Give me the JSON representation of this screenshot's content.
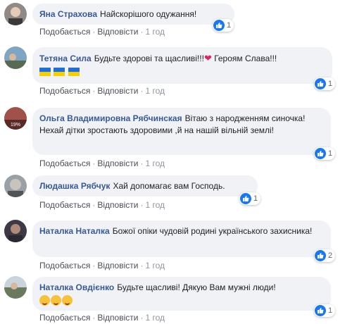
{
  "actions": {
    "like": "Подобається",
    "reply": "Відповісти",
    "sep": "·"
  },
  "comments": [
    {
      "author": "Яна Страхова",
      "text": "Найскорішого одужання!",
      "time": "1 год",
      "likes": "1"
    },
    {
      "author": "Тетяна Сила",
      "text": "Будьте здорові та щасливі!!!",
      "text2": "Героям Слава!!!",
      "time": "1 год",
      "likes": "1",
      "extra": [
        "flag-ua",
        "flag-ua",
        "flag-ua"
      ]
    },
    {
      "author": "Ольга Владимировна Рябчинская",
      "text": "Вітаю з народженням синочка!Нехай дітки зростають здоровими ,й на нашій вільній землі!",
      "time": "1 год",
      "likes": "1"
    },
    {
      "author": "Людашка Рябчук",
      "text": "Хай допомагає вам Господь.",
      "time": "1 год",
      "likes": "1"
    },
    {
      "author": "Наталка Наталка",
      "text": "Божої опіки чудовій родині українського захисника!",
      "time": "1 год",
      "likes": "2"
    },
    {
      "author": "Наталка Овдієнко",
      "text": "Будьте щасливі! Дякую Вам мужні люди!",
      "time": "1 год",
      "likes": "1",
      "extra": [
        "smiling-face-with-hearts-emoji",
        "smiling-face-with-hearts-emoji",
        "smiling-face-with-hearts-emoji"
      ]
    }
  ],
  "colors": {
    "author": "#385898",
    "bubble": "#f0f2f5",
    "like": "#1877f2"
  }
}
